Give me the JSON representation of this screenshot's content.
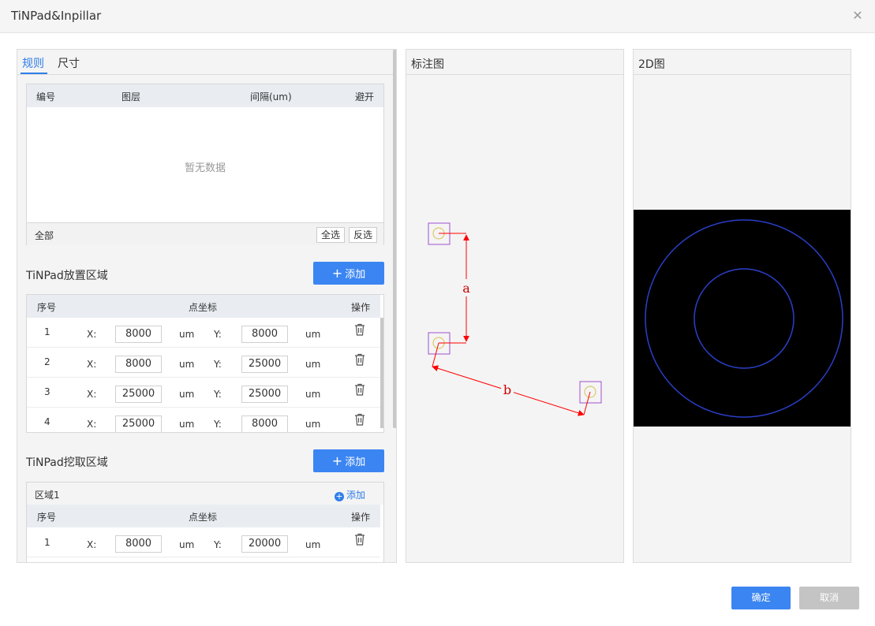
{
  "window": {
    "title": "TiNPad&Inpillar",
    "close_icon": "close-icon"
  },
  "left": {
    "tabs": [
      {
        "label": "规则"
      },
      {
        "label": "尺寸"
      }
    ],
    "rule_table": {
      "headers": [
        "编号",
        "图层",
        "间隔(um)",
        "避开"
      ],
      "empty_text": "暂无数据",
      "footer_label": "全部",
      "select_all": "全选",
      "invert": "反选"
    },
    "placement": {
      "title": "TiNPad放置区域",
      "add_label": "添加",
      "headers": [
        "序号",
        "点坐标",
        "操作"
      ],
      "x_label": "X:",
      "y_label": "Y:",
      "unit": "um",
      "rows": [
        {
          "no": "1",
          "x": "8000",
          "y": "8000"
        },
        {
          "no": "2",
          "x": "8000",
          "y": "25000"
        },
        {
          "no": "3",
          "x": "25000",
          "y": "25000"
        },
        {
          "no": "4",
          "x": "25000",
          "y": "8000"
        }
      ]
    },
    "dig": {
      "title": "TiNPad挖取区域",
      "add_label": "添加",
      "area_label": "区域1",
      "area_add_label": "添加",
      "headers": [
        "序号",
        "点坐标",
        "操作"
      ],
      "rows": [
        {
          "no": "1",
          "x": "8000",
          "y": "20000"
        }
      ]
    }
  },
  "annotation": {
    "title": "标注图",
    "label_a": "a",
    "label_b": "b",
    "arrow_color": "#ff0000",
    "box_color": "#a050d0"
  },
  "view2d": {
    "title": "2D图",
    "background": "#000000",
    "ring_color": "#2a3fc8"
  },
  "footer": {
    "ok_label": "确定",
    "cancel_label": "取消"
  }
}
